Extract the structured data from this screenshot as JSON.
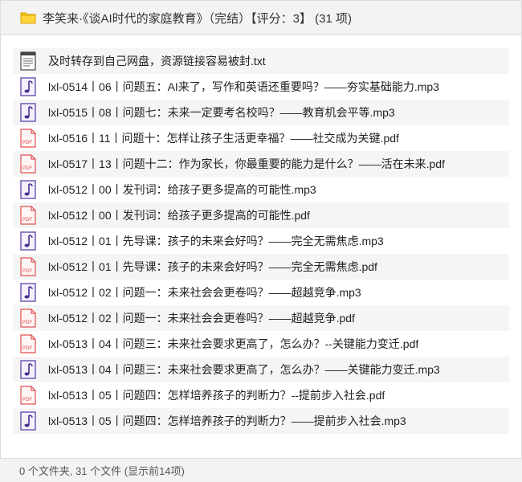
{
  "header": {
    "title": "李笑来·《谈AI时代的家庭教育》（完结）【评分：3】 (31 项)",
    "icon": "folder-icon"
  },
  "files": [
    {
      "name": "及时转存到自己网盘，资源链接容易被封.txt",
      "type": "txt"
    },
    {
      "name": "lxl-0514丨06丨问题五：AI来了，写作和英语还重要吗？——夯实基础能力.mp3",
      "type": "mp3"
    },
    {
      "name": "lxl-0515丨08丨问题七：未来一定要考名校吗？——教育机会平等.mp3",
      "type": "mp3"
    },
    {
      "name": "lxl-0516丨11丨问题十：怎样让孩子生活更幸福？——社交成为关键.pdf",
      "type": "pdf"
    },
    {
      "name": "lxl-0517丨13丨问题十二：作为家长，你最重要的能力是什么？——活在未来.pdf",
      "type": "pdf"
    },
    {
      "name": "lxl-0512丨00丨发刊词：给孩子更多提高的可能性.mp3",
      "type": "mp3"
    },
    {
      "name": "lxl-0512丨00丨发刊词：给孩子更多提高的可能性.pdf",
      "type": "pdf"
    },
    {
      "name": "lxl-0512丨01丨先导课：孩子的未来会好吗？——完全无需焦虑.mp3",
      "type": "mp3"
    },
    {
      "name": "lxl-0512丨01丨先导课：孩子的未来会好吗？——完全无需焦虑.pdf",
      "type": "pdf"
    },
    {
      "name": "lxl-0512丨02丨问题一：未来社会会更卷吗？——超越竞争.mp3",
      "type": "mp3"
    },
    {
      "name": "lxl-0512丨02丨问题一：未来社会会更卷吗？——超越竞争.pdf",
      "type": "pdf"
    },
    {
      "name": "lxl-0513丨04丨问题三：未来社会要求更高了，怎么办？--关键能力变迁.pdf",
      "type": "pdf"
    },
    {
      "name": "lxl-0513丨04丨问题三：未来社会要求更高了，怎么办？——关键能力变迁.mp3",
      "type": "mp3"
    },
    {
      "name": "lxl-0513丨05丨问题四：怎样培养孩子的判断力？--提前步入社会.pdf",
      "type": "pdf"
    },
    {
      "name": "lxl-0513丨05丨问题四：怎样培养孩子的判断力？——提前步入社会.mp3",
      "type": "mp3"
    }
  ],
  "footer": {
    "summary": "0 个文件夹, 31 个文件 (显示前14项)"
  },
  "colors": {
    "folder": "#f5c518",
    "mp3": "#6a4fb0",
    "pdf": "#e05050"
  }
}
